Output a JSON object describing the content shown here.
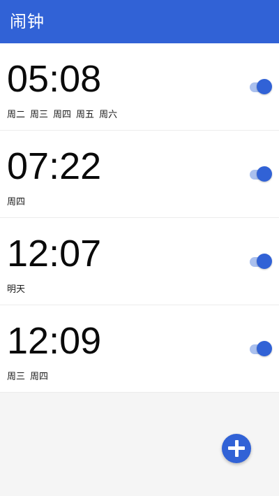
{
  "app_bar": {
    "title": "闹钟",
    "color": "#3162d6"
  },
  "alarms": [
    {
      "time": "05:08",
      "days": [
        "周二",
        "周三",
        "周四",
        "周五",
        "周六"
      ],
      "enabled": true
    },
    {
      "time": "07:22",
      "days": [
        "周四"
      ],
      "enabled": true
    },
    {
      "time": "12:07",
      "days": [
        "明天"
      ],
      "enabled": true
    },
    {
      "time": "12:09",
      "days": [
        "周三",
        "周四"
      ],
      "enabled": true
    }
  ],
  "fab": {
    "icon": "plus-icon"
  }
}
